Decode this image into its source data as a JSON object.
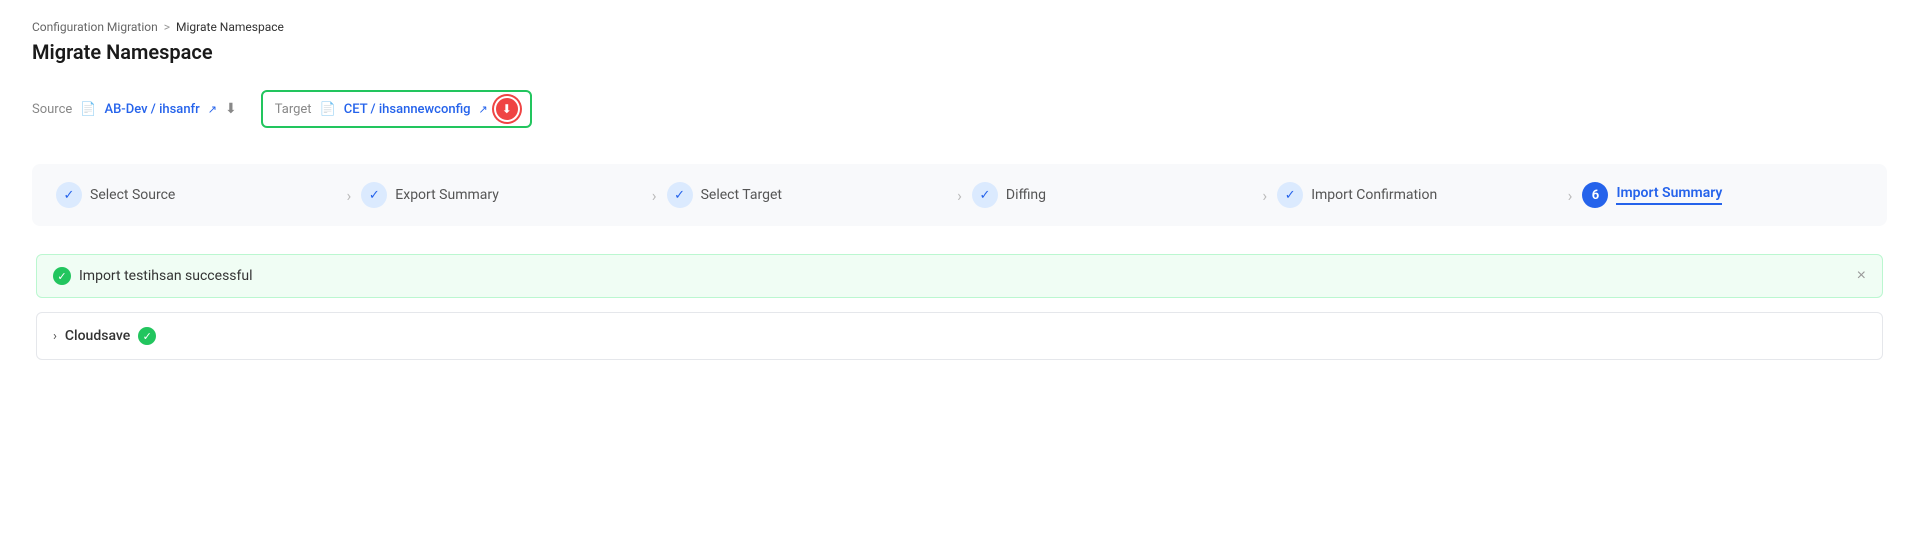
{
  "breadcrumb": {
    "parent": "Configuration Migration",
    "separator": ">",
    "current": "Migrate Namespace"
  },
  "page_title": "Migrate Namespace",
  "source_bar": {
    "source_label": "Source",
    "source_value": "AB-Dev / ihsanfr",
    "target_label": "Target",
    "target_value": "CET / ihsannewconfig"
  },
  "steps": [
    {
      "id": 1,
      "label": "Select Source",
      "status": "done",
      "check": "✓"
    },
    {
      "id": 2,
      "label": "Export Summary",
      "status": "done",
      "check": "✓"
    },
    {
      "id": 3,
      "label": "Select Target",
      "status": "done",
      "check": "✓"
    },
    {
      "id": 4,
      "label": "Diffing",
      "status": "done",
      "check": "✓"
    },
    {
      "id": 5,
      "label": "Import Confirmation",
      "status": "done",
      "check": "✓"
    },
    {
      "id": 6,
      "label": "Import Summary",
      "status": "active",
      "check": "6"
    }
  ],
  "success_message": "Import testihsan successful",
  "close_label": "×",
  "cloudsave_label": "Cloudsave",
  "colors": {
    "blue": "#2563eb",
    "green": "#22c55e",
    "red": "#ef4444",
    "light_blue_bg": "#dbeafe",
    "success_bg": "#f0fdf4",
    "success_border": "#bbf7d0"
  }
}
